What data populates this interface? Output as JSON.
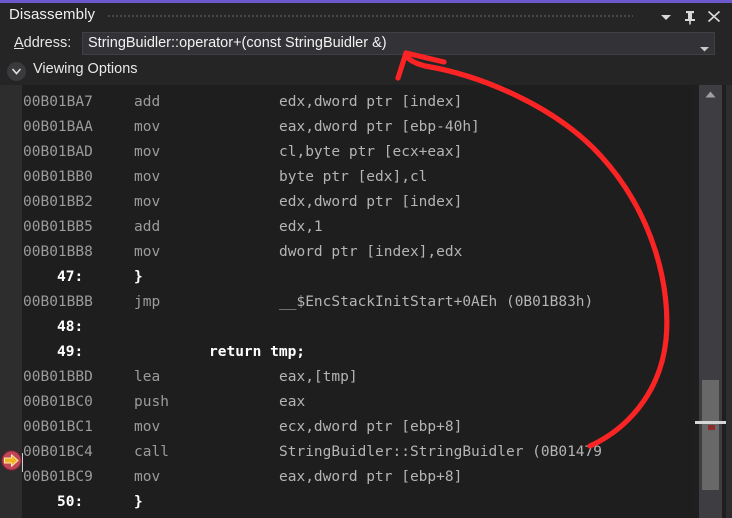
{
  "window": {
    "title": "Disassembly",
    "accent_color": "#6a5acd",
    "titlebar_buttons": [
      {
        "name": "window-menu-dropdown",
        "icon": "chevron-down-icon",
        "label": "Window menu"
      },
      {
        "name": "pin-window",
        "icon": "pin-icon",
        "label": "Auto Hide"
      },
      {
        "name": "close-window",
        "icon": "close-icon",
        "label": "Close"
      }
    ]
  },
  "address_bar": {
    "label": "Address:",
    "label_accelerator": "A",
    "value": "StringBuidler::operator+(const StringBuidler &)",
    "placeholder": "Address",
    "dropdown_icon": "chevron-down-icon"
  },
  "viewing_options": {
    "label": "Viewing Options",
    "expanded": false,
    "chevron_icon": "chevron-down-icon"
  },
  "code": {
    "current_instruction_marker_icon": "current-statement-arrow-icon",
    "current_instruction_line_index": 11,
    "lines": [
      {
        "kind": "asm",
        "address": "00B01BA7",
        "mnemonic": "add",
        "operands": "edx,dword ptr [index]"
      },
      {
        "kind": "asm",
        "address": "00B01BAA",
        "mnemonic": "mov",
        "operands": "eax,dword ptr [ebp-40h]"
      },
      {
        "kind": "asm",
        "address": "00B01BAD",
        "mnemonic": "mov",
        "operands": "cl,byte ptr [ecx+eax]"
      },
      {
        "kind": "asm",
        "address": "00B01BB0",
        "mnemonic": "mov",
        "operands": "byte ptr [edx],cl"
      },
      {
        "kind": "asm",
        "address": "00B01BB2",
        "mnemonic": "mov",
        "operands": "edx,dword ptr [index]"
      },
      {
        "kind": "asm",
        "address": "00B01BB5",
        "mnemonic": "add",
        "operands": "edx,1"
      },
      {
        "kind": "asm",
        "address": "00B01BB8",
        "mnemonic": "mov",
        "operands": "dword ptr [index],edx"
      },
      {
        "kind": "src",
        "number": "47:",
        "text": "}",
        "indent": "normal"
      },
      {
        "kind": "asm",
        "address": "00B01BBB",
        "mnemonic": "jmp",
        "operands": "__$EncStackInitStart+0AEh (0B01B83h)"
      },
      {
        "kind": "src",
        "number": "48:",
        "text": "",
        "indent": "normal"
      },
      {
        "kind": "src",
        "number": "49:",
        "text": "return tmp;",
        "indent": "deep"
      },
      {
        "kind": "asm",
        "address": "00B01BBD",
        "mnemonic": "lea",
        "operands": "eax,[tmp]"
      },
      {
        "kind": "asm",
        "address": "00B01BC0",
        "mnemonic": "push",
        "operands": "eax"
      },
      {
        "kind": "asm",
        "address": "00B01BC1",
        "mnemonic": "mov",
        "operands": "ecx,dword ptr [ebp+8]"
      },
      {
        "kind": "asm",
        "address": "00B01BC4",
        "mnemonic": "call",
        "operands": "StringBuidler::StringBuidler (0B01479"
      },
      {
        "kind": "asm",
        "address": "00B01BC9",
        "mnemonic": "mov",
        "operands": "eax,dword ptr [ebp+8]"
      },
      {
        "kind": "src",
        "number": "50:",
        "text": "}",
        "indent": "normal"
      }
    ]
  },
  "scrollbar": {
    "up_arrow_icon": "triangle-up-icon",
    "thumb_label": "vertical-scroll-thumb"
  },
  "annotation": {
    "color": "#fb2424",
    "shape": "curved-arrow",
    "points_to": "address-combobox"
  }
}
